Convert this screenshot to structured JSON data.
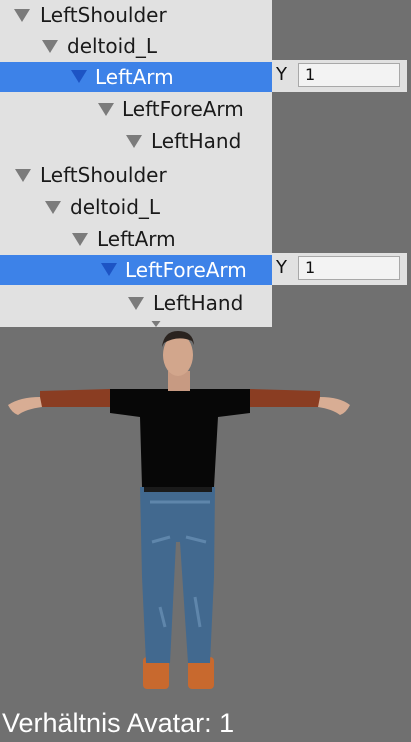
{
  "hierarchy": {
    "rows": [
      {
        "label": "LeftShoulder",
        "selected": false
      },
      {
        "label": "deltoid_L",
        "selected": false
      },
      {
        "label": "LeftArm",
        "selected": true
      },
      {
        "label": "LeftForeArm",
        "selected": false
      },
      {
        "label": "LeftHand",
        "selected": false
      },
      {
        "label": "LeftShoulder",
        "selected": false
      },
      {
        "label": "deltoid_L",
        "selected": false
      },
      {
        "label": "LeftArm",
        "selected": false
      },
      {
        "label": "LeftForeArm",
        "selected": true
      },
      {
        "label": "LeftHand",
        "selected": false
      }
    ]
  },
  "fields": [
    {
      "label": "Y",
      "value": "1"
    },
    {
      "label": "Y",
      "value": "1"
    }
  ],
  "status": {
    "text": "Verhältnis Avatar: 1"
  },
  "colors": {
    "viewport_background": "#707070",
    "panel_background": "#e1e1e1",
    "selection": "#3d82e8",
    "selection_arrow": "#1d54c4",
    "status_text": "#ffffff"
  }
}
